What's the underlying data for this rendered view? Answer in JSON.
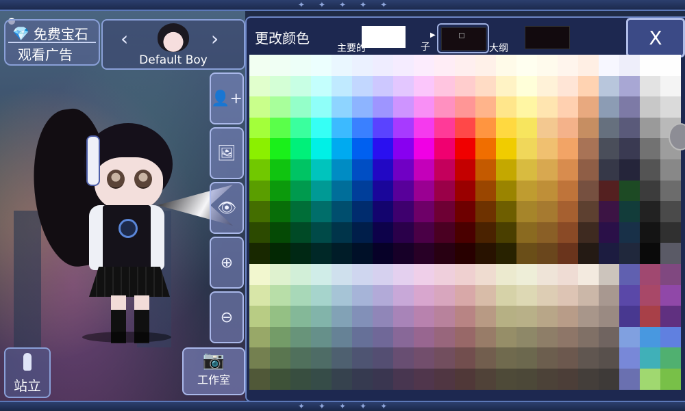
{
  "gem_button": {
    "line1": "免费宝石",
    "line2": "观看广告"
  },
  "character_select": {
    "left_arrow": "‹",
    "right_arrow": "›",
    "name": "Default Boy"
  },
  "tools": [
    {
      "name": "add-character-icon",
      "glyph": "👤+"
    },
    {
      "name": "background-icon",
      "glyph": "🖼"
    },
    {
      "name": "eye-icon",
      "glyph": "👁"
    },
    {
      "name": "zoom-in-icon",
      "glyph": "⊕"
    },
    {
      "name": "zoom-out-icon",
      "glyph": "⊖"
    }
  ],
  "stand_button": {
    "label": "站立"
  },
  "studio_button": {
    "label": "工作室"
  },
  "panel": {
    "title": "更改颜色",
    "primary_label": "主要的",
    "child_label": "子",
    "outline_label": "大纲",
    "close_label": "X",
    "primary_color": "#ffffff",
    "child_color": "#150c10",
    "outline_color": "#120a0e"
  },
  "palette": [
    [
      "#f2fff2",
      "#f0fff4",
      "#edfff8",
      "#ecfffe",
      "#eaf7ff",
      "#ebf1ff",
      "#efedff",
      "#f5ecff",
      "#fcecfd",
      "#ffedf6",
      "#ffefef",
      "#fff1e9",
      "#fffbe9",
      "#fffff0",
      "#fffbed",
      "#fff5ed",
      "#ffefe4",
      "#f7f7ff",
      "#eeeefa",
      "#fefefe",
      "#fefefe"
    ],
    [
      "#e1ffcd",
      "#d4ffd6",
      "#c8ffe4",
      "#c4fffd",
      "#c0eaff",
      "#c2d7ff",
      "#cdc8ff",
      "#e3c7ff",
      "#fbc6fb",
      "#ffc5e0",
      "#ffcdcd",
      "#ffdcc5",
      "#fff3c5",
      "#ffffd9",
      "#fff2d8",
      "#ffe5d6",
      "#ffd3b2",
      "#b8c6dc",
      "#a8a7d4",
      "#e3e3e3",
      "#f4f4f4"
    ],
    [
      "#c9ff8b",
      "#a8ff9b",
      "#94ffc9",
      "#8ffff9",
      "#8ed4ff",
      "#8db4ff",
      "#9e95ff",
      "#ce94ff",
      "#f88ff5",
      "#ff90c0",
      "#ff9696",
      "#ffb48b",
      "#ffe68b",
      "#fff6a3",
      "#ffe5b0",
      "#ffd0b0",
      "#e8a97f",
      "#8c9cb4",
      "#7d7aa6",
      "#c8c8c8",
      "#dadada"
    ],
    [
      "#a3ff3a",
      "#5aff4a",
      "#3aff9e",
      "#36fff5",
      "#3cbaff",
      "#3a80ff",
      "#5a43ff",
      "#a73aff",
      "#f53aee",
      "#ff3a98",
      "#ff4848",
      "#ff9540",
      "#ffd940",
      "#f7e55e",
      "#f3c890",
      "#f4b28a",
      "#c68e62",
      "#66707e",
      "#5a5a7a",
      "#9a9a9a",
      "#b9b9b9"
    ],
    [
      "#8bf000",
      "#1af01a",
      "#00f07a",
      "#00f0e6",
      "#00aaf0",
      "#0060f0",
      "#2a10f0",
      "#8800f0",
      "#f000e4",
      "#f00070",
      "#f00000",
      "#f06e00",
      "#f0cc00",
      "#f0d75a",
      "#f0c070",
      "#f2a466",
      "#a87356",
      "#4a4e5a",
      "#3a3a52",
      "#727272",
      "#9d9d9d"
    ],
    [
      "#71c800",
      "#10c410",
      "#00c464",
      "#00c4bd",
      "#008cc4",
      "#004ec4",
      "#2208c4",
      "#7000c4",
      "#c400ba",
      "#c4005c",
      "#c40000",
      "#c45a00",
      "#c4a800",
      "#d8bb40",
      "#d8a850",
      "#d88c4e",
      "#8f5e46",
      "#363848",
      "#25253a",
      "#545454",
      "#888888"
    ],
    [
      "#5a9e00",
      "#0c9a0c",
      "#009a4e",
      "#009a95",
      "#006e9a",
      "#003e9a",
      "#1a069a",
      "#58009a",
      "#9a0092",
      "#9a0048",
      "#9a0000",
      "#9a4600",
      "#9a8400",
      "#bf9c30",
      "#bf8f38",
      "#bf743a",
      "#765040",
      "#542020",
      "#1d4a24",
      "#3c3c3c",
      "#6c6c6c"
    ],
    [
      "#446e00",
      "#086e08",
      "#006e38",
      "#006e6a",
      "#004e6e",
      "#002c6e",
      "#13046e",
      "#3e006e",
      "#6e0068",
      "#6e0034",
      "#6e0000",
      "#6e3200",
      "#6e5e00",
      "#a6852a",
      "#a67a30",
      "#a66030",
      "#5d4030",
      "#3c1444",
      "#123c3a",
      "#222222",
      "#4a4a4a"
    ],
    [
      "#2c4a00",
      "#054a05",
      "#004a26",
      "#004a48",
      "#00344a",
      "#001e4a",
      "#0d024a",
      "#2a004a",
      "#4a0046",
      "#4a0022",
      "#4a0000",
      "#4a2200",
      "#4a3f00",
      "#8a6a20",
      "#8a5f26",
      "#8a4a26",
      "#3e2a20",
      "#2a1048",
      "#183048",
      "#141414",
      "#303030"
    ],
    [
      "#182800",
      "#032803",
      "#002814",
      "#002827",
      "#001c28",
      "#001028",
      "#070128",
      "#170028",
      "#280026",
      "#280012",
      "#280000",
      "#281200",
      "#282200",
      "#6a4e18",
      "#6a461c",
      "#6a341c",
      "#241a14",
      "#1c1c40",
      "#20283c",
      "#0a0a0a",
      "#5a5a66"
    ],
    [
      "#f2f7cf",
      "#dff2cf",
      "#d2efd8",
      "#d0ede8",
      "#cfe0ed",
      "#cfd6ef",
      "#d6d1ef",
      "#e4d0ef",
      "#efcfe9",
      "#efcfdc",
      "#efd0d0",
      "#efdcd0",
      "#eceacf",
      "#eeeed8",
      "#efe4d8",
      "#efdcd4",
      "#f3eadf",
      "#ccc4bc",
      "#6060b0",
      "#a04870",
      "#804880"
    ],
    [
      "#d8e6a8",
      "#b8dea8",
      "#a8d8b8",
      "#a6d4cc",
      "#a6c4d6",
      "#a6b4d8",
      "#b2aad8",
      "#c8a8d8",
      "#d8a6ce",
      "#d8a6be",
      "#d8a8a8",
      "#d8bca8",
      "#d6d2a8",
      "#ddd8b4",
      "#ddcdb4",
      "#ddc4b4",
      "#cbb7a8",
      "#a89890",
      "#5a48a8",
      "#a84868",
      "#9048a8"
    ],
    [
      "#b8cc84",
      "#94c084",
      "#84b898",
      "#82b4aa",
      "#82a2b6",
      "#8290b8",
      "#9086b8",
      "#a884b8",
      "#b882ae",
      "#b8829c",
      "#b88484",
      "#b89a84",
      "#b6b084",
      "#b8b088",
      "#b8a688",
      "#b89c88",
      "#a8968a",
      "#9a8a82",
      "#483890",
      "#a84048",
      "#603080"
    ],
    [
      "#98a868",
      "#749c68",
      "#68947a",
      "#66908a",
      "#668296",
      "#667098",
      "#706898",
      "#886898",
      "#986690",
      "#98667c",
      "#986868",
      "#987c68",
      "#968e68",
      "#8e8868",
      "#8e7e68",
      "#8e7668",
      "#807066",
      "#706460",
      "#80a0e0",
      "#4898e0",
      "#6080e0"
    ],
    [
      "#748050",
      "#5a7650",
      "#50705c",
      "#4e6c66",
      "#4e6070",
      "#4e5472",
      "#544e72",
      "#684e72",
      "#724e6c",
      "#724e5e",
      "#724e4e",
      "#725e4e",
      "#706a4e",
      "#6c684e",
      "#6c5e4e",
      "#6c584e",
      "#605650",
      "#58504c",
      "#7888d8",
      "#40b0b8",
      "#50b070"
    ],
    [
      "#505838",
      "#3e5238",
      "#384e40",
      "#364c48",
      "#36424e",
      "#363a50",
      "#3a3650",
      "#483650",
      "#50364c",
      "#503642",
      "#503838",
      "#504238",
      "#4e4a38",
      "#4c4838",
      "#4c4238",
      "#4c3e38",
      "#443e3a",
      "#3e3a38",
      "#6a70b0",
      "#a0d870",
      "#78c048"
    ]
  ]
}
